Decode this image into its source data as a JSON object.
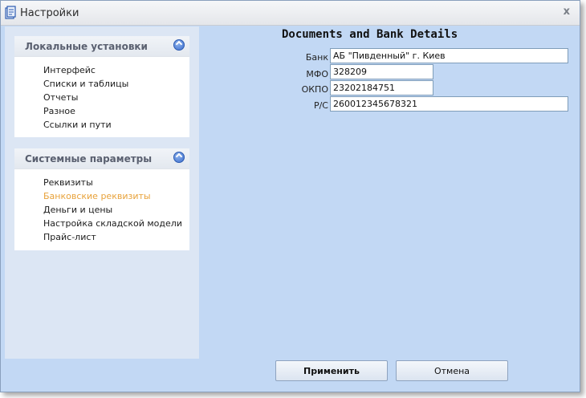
{
  "window": {
    "title": "Настройки",
    "icons": {
      "app": "settings-document-icon",
      "close": "close-icon"
    },
    "close_glyph": "x"
  },
  "sidebar": {
    "local": {
      "header": "Локальные установки",
      "items": [
        "Интерфейс",
        "Списки и таблицы",
        "Отчеты",
        "Разное",
        "Ссылки и пути"
      ]
    },
    "system": {
      "header": "Системные параметры",
      "items": [
        "Реквизиты",
        "Банковские реквизиты",
        "Деньги и цены",
        "Настройка складской модели",
        "Прайс-лист"
      ],
      "active_item": "Банковские реквизиты"
    }
  },
  "main": {
    "title": "Documents and Bank Details",
    "fields": {
      "bank": {
        "label": "Банк",
        "value": "АБ \"Пивденный\" г. Киев"
      },
      "mfo": {
        "label": "МФО",
        "value": "328209"
      },
      "okpo": {
        "label": "ОКПО",
        "value": "23202184751"
      },
      "account": {
        "label": "Р/С",
        "value": "260012345678321"
      }
    }
  },
  "buttons": {
    "apply": "Применить",
    "cancel": "Отмена"
  },
  "colors": {
    "background": "#c2d8f4",
    "active_link": "#e8a23a",
    "accent": "#3d6fce"
  }
}
